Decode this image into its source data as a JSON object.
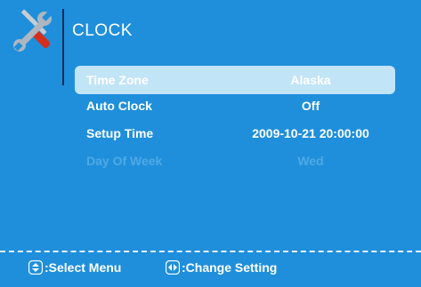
{
  "header": {
    "title": "CLOCK",
    "icon": "tools-icon"
  },
  "menu": {
    "items": [
      {
        "label": "Time Zone",
        "value": "Alaska",
        "state": "selected"
      },
      {
        "label": "Auto Clock",
        "value": "Off",
        "state": "normal"
      },
      {
        "label": "Setup Time",
        "value": "2009-10-21 20:00:00",
        "state": "normal"
      },
      {
        "label": "Day Of Week",
        "value": "Wed",
        "state": "disabled"
      }
    ]
  },
  "footer": {
    "select_hint": ":Select Menu",
    "select_icon": "up-down-arrows-icon",
    "change_hint": ":Change Setting",
    "change_icon": "left-right-arrows-icon"
  },
  "colors": {
    "background": "#1f8fdb",
    "highlight": "#c2e4f7",
    "disabled_text": "#4fa9e4",
    "divider": "#0a2e55"
  }
}
